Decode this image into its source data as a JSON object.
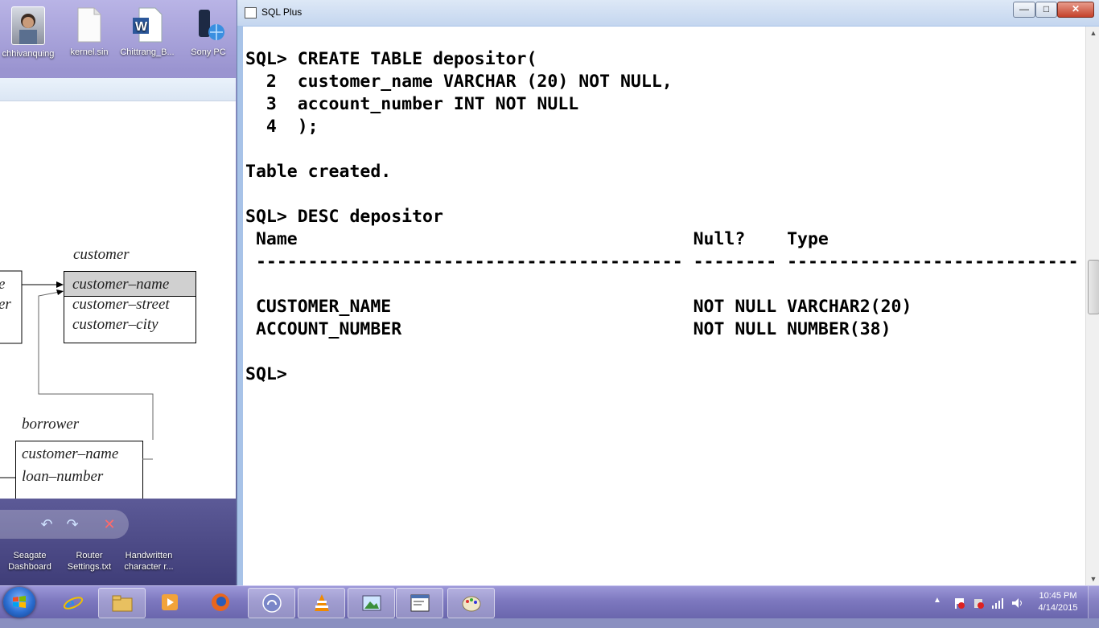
{
  "desktop": {
    "top_icons": [
      {
        "name": "user-photo-icon",
        "label": "chhivanquing"
      },
      {
        "name": "text-file-icon",
        "label": "kernel.sin"
      },
      {
        "name": "word-doc-icon",
        "label": "Chittrang_B..."
      },
      {
        "name": "sony-pc-icon",
        "label": "Sony PC"
      }
    ],
    "bottom_icons": [
      {
        "name": "seagate-icon",
        "label": "Seagate Dashboard"
      },
      {
        "name": "router-settings-icon",
        "label": "Router Settings.txt"
      },
      {
        "name": "handwritten-icon",
        "label": "Handwritten character r..."
      }
    ]
  },
  "diagram": {
    "customer_title": "customer",
    "customer_fields": [
      "customer–name",
      "customer–street",
      "customer–city"
    ],
    "borrower_title": "borrower",
    "borrower_fields": [
      "customer–name",
      "loan–number"
    ],
    "left_fragments": [
      "e",
      "er"
    ]
  },
  "sqlplus": {
    "title": "SQL Plus",
    "controls": {
      "minimize": "—",
      "maximize": "□",
      "close": "✕"
    },
    "lines": [
      "SQL> CREATE TABLE depositor(",
      "  2  customer_name VARCHAR (20) NOT NULL,",
      "  3  account_number INT NOT NULL",
      "  4  );",
      "",
      "Table created.",
      "",
      "SQL> DESC depositor",
      " Name                                      Null?    Type",
      " ----------------------------------------- -------- ----------------------------",
      "",
      " CUSTOMER_NAME                             NOT NULL VARCHAR2(20)",
      " ACCOUNT_NUMBER                            NOT NULL NUMBER(38)",
      "",
      "SQL>"
    ]
  },
  "taskbar": {
    "pinned": [
      {
        "name": "internet-explorer-icon"
      },
      {
        "name": "file-explorer-icon"
      },
      {
        "name": "media-player-icon"
      },
      {
        "name": "firefox-icon"
      },
      {
        "name": "bittorrent-icon"
      },
      {
        "name": "vlc-icon"
      },
      {
        "name": "photo-viewer-icon"
      },
      {
        "name": "sqlplus-task-icon"
      },
      {
        "name": "paint-icon"
      }
    ],
    "clock": {
      "time": "10:45 PM",
      "date": "4/14/2015"
    }
  },
  "colors": {
    "accent": "#2a6ccf",
    "console_bg": "#ffffff",
    "console_text": "#000000"
  }
}
